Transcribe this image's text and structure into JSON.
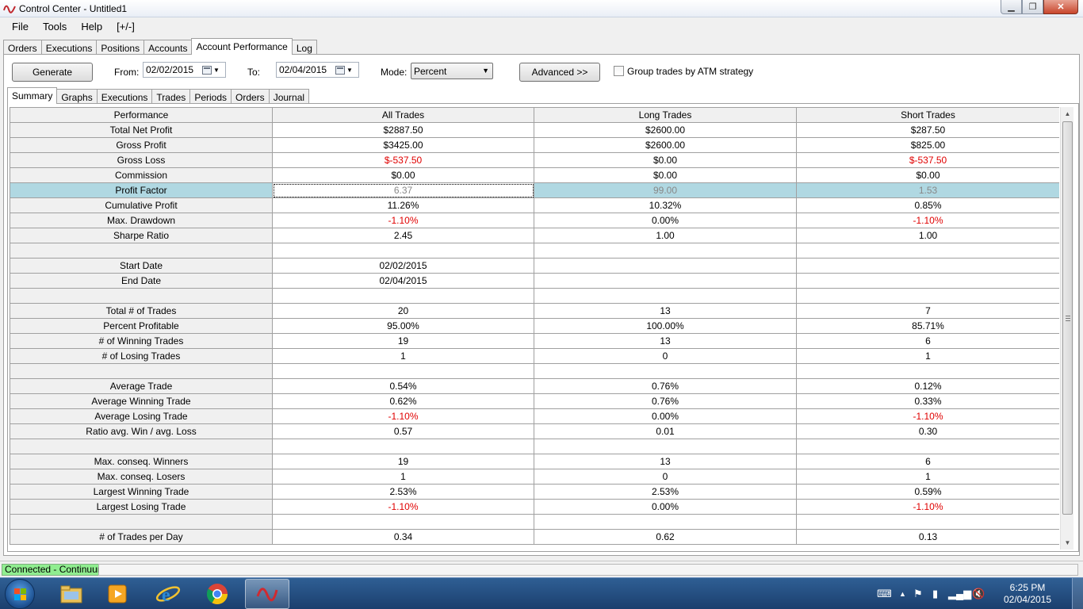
{
  "window": {
    "title": "Control Center - Untitled1"
  },
  "menu": [
    "File",
    "Tools",
    "Help",
    "[+/-]"
  ],
  "main_tabs": [
    "Orders",
    "Executions",
    "Positions",
    "Accounts",
    "Account Performance",
    "Log"
  ],
  "toolbar": {
    "generate": "Generate",
    "from_label": "From:",
    "from_value": "02/02/2015",
    "to_label": "To:",
    "to_value": "02/04/2015",
    "mode_label": "Mode:",
    "mode_value": "Percent",
    "advanced": "Advanced >>",
    "group_label": "Group trades by ATM strategy"
  },
  "sub_tabs": [
    "Summary",
    "Graphs",
    "Executions",
    "Trades",
    "Periods",
    "Orders",
    "Journal"
  ],
  "table": {
    "headers": [
      "Performance",
      "All Trades",
      "Long Trades",
      "Short Trades"
    ],
    "rows": [
      [
        "Total Net Profit",
        "$2887.50",
        "$2600.00",
        "$287.50"
      ],
      [
        "Gross Profit",
        "$3425.00",
        "$2600.00",
        "$825.00"
      ],
      [
        "Gross Loss",
        "$-537.50",
        "$0.00",
        "$-537.50"
      ],
      [
        "Commission",
        "$0.00",
        "$0.00",
        "$0.00"
      ],
      [
        "Profit Factor",
        "6.37",
        "99.00",
        "1.53"
      ],
      [
        "Cumulative Profit",
        "11.26%",
        "10.32%",
        "0.85%"
      ],
      [
        "Max. Drawdown",
        "-1.10%",
        "0.00%",
        "-1.10%"
      ],
      [
        "Sharpe Ratio",
        "2.45",
        "1.00",
        "1.00"
      ],
      [
        "",
        "",
        "",
        ""
      ],
      [
        "Start Date",
        "02/02/2015",
        "",
        ""
      ],
      [
        "End Date",
        "02/04/2015",
        "",
        ""
      ],
      [
        "",
        "",
        "",
        ""
      ],
      [
        "Total # of Trades",
        "20",
        "13",
        "7"
      ],
      [
        "Percent Profitable",
        "95.00%",
        "100.00%",
        "85.71%"
      ],
      [
        "# of Winning Trades",
        "19",
        "13",
        "6"
      ],
      [
        "# of Losing Trades",
        "1",
        "0",
        "1"
      ],
      [
        "",
        "",
        "",
        ""
      ],
      [
        "Average Trade",
        "0.54%",
        "0.76%",
        "0.12%"
      ],
      [
        "Average Winning Trade",
        "0.62%",
        "0.76%",
        "0.33%"
      ],
      [
        "Average Losing Trade",
        "-1.10%",
        "0.00%",
        "-1.10%"
      ],
      [
        "Ratio avg. Win / avg. Loss",
        "0.57",
        "0.01",
        "0.30"
      ],
      [
        "",
        "",
        "",
        ""
      ],
      [
        "Max. conseq. Winners",
        "19",
        "13",
        "6"
      ],
      [
        "Max. conseq. Losers",
        "1",
        "0",
        "1"
      ],
      [
        "Largest Winning Trade",
        "2.53%",
        "2.53%",
        "0.59%"
      ],
      [
        "Largest Losing Trade",
        "-1.10%",
        "0.00%",
        "-1.10%"
      ],
      [
        "",
        "",
        "",
        ""
      ],
      [
        "# of Trades per Day",
        "0.34",
        "0.62",
        "0.13"
      ]
    ],
    "selected_row": "Profit Factor",
    "negative_color": "#e00000",
    "selected_color": "#b0d8e2"
  },
  "status": {
    "connection": "Connected - Continuum",
    "connection_color": "#90ee90"
  },
  "taskbar": {
    "items": [
      "start-orb",
      "file-explorer-icon",
      "media-player-icon",
      "internet-explorer-icon",
      "chrome-icon",
      "ninjatrader-icon"
    ],
    "time": "6:25 PM",
    "date": "02/04/2015"
  }
}
